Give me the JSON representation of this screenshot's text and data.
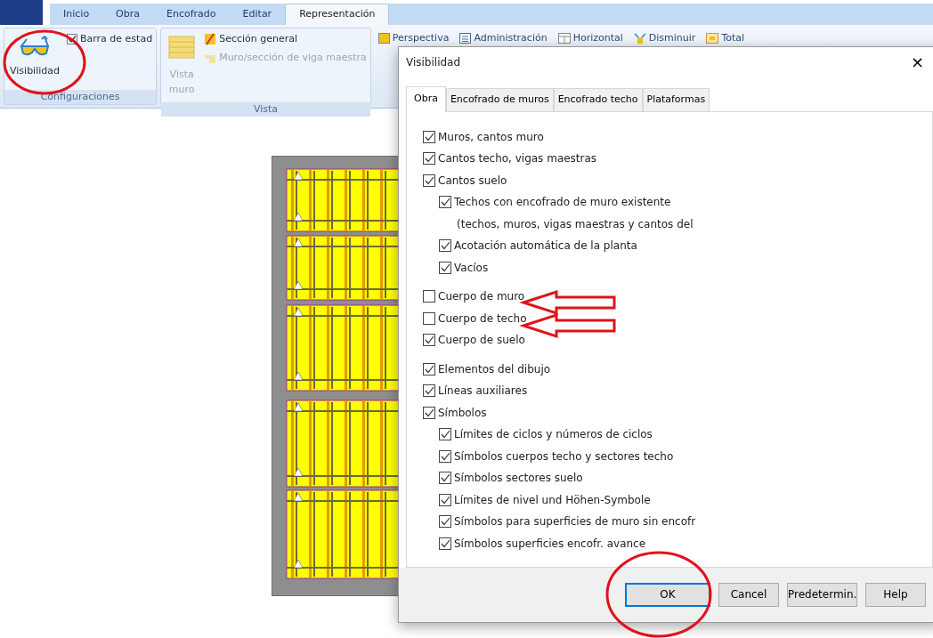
{
  "ribbon_tabs": [
    {
      "label": "Inicio",
      "selected": false
    },
    {
      "label": "Obra",
      "selected": false
    },
    {
      "label": "Encofrado",
      "selected": false
    },
    {
      "label": "Editar",
      "selected": false
    },
    {
      "label": "Representación",
      "selected": true
    }
  ],
  "ribbon_groups": [
    {
      "title": "Configuraciones",
      "items": [
        {
          "kind": "large",
          "label": "Visibilidad",
          "disabled": false
        },
        {
          "kind": "check",
          "label": "Barra de estad",
          "checked": true,
          "disabled": false
        }
      ]
    },
    {
      "title": "Vista",
      "items": [
        {
          "kind": "large",
          "label": "Vista muro",
          "disabled": true
        },
        {
          "kind": "small",
          "label": "Sección general",
          "disabled": false
        },
        {
          "kind": "small",
          "label": "Muro/sección de viga maestra",
          "disabled": true
        }
      ]
    }
  ],
  "ribbon_partial_items": [
    {
      "label": "Perspectiva"
    },
    {
      "label": "Administración"
    },
    {
      "label": "Horizontal"
    },
    {
      "label": "Disminuir"
    },
    {
      "label": "Total"
    }
  ],
  "dialog": {
    "title": "Visibilidad",
    "close": "×",
    "tabs": [
      {
        "label": "Obra",
        "selected": true
      },
      {
        "label": "Encofrado de muros",
        "selected": false
      },
      {
        "label": "Encofrado techo",
        "selected": false
      },
      {
        "label": "Plataformas",
        "selected": false
      }
    ],
    "groups": [
      {
        "items": [
          {
            "label": "Muros, cantos muro",
            "checked": true
          },
          {
            "label": "Cantos techo, vigas maestras",
            "checked": true
          },
          {
            "label": "Cantos suelo",
            "checked": true,
            "children": [
              {
                "label": "Techos con encofrado de muro existente",
                "note": "(techos, muros, vigas maestras y cantos del",
                "checked": true
              },
              {
                "label": "Acotación automática de la planta",
                "checked": true
              },
              {
                "label": "Vacíos",
                "checked": true
              }
            ]
          }
        ]
      },
      {
        "items": [
          {
            "label": "Cuerpo de muro",
            "checked": false
          },
          {
            "label": "Cuerpo de techo",
            "checked": false
          },
          {
            "label": "Cuerpo de suelo",
            "checked": true
          }
        ]
      },
      {
        "items": [
          {
            "label": "Elementos del dibujo",
            "checked": true
          },
          {
            "label": "Líneas auxiliares",
            "checked": true
          },
          {
            "label": "Símbolos",
            "checked": true,
            "children": [
              {
                "label": "Límites de ciclos y números de ciclos",
                "checked": true
              },
              {
                "label": "Símbolos cuerpos techo y sectores techo",
                "checked": true
              },
              {
                "label": "Símbolos sectores suelo",
                "checked": true
              },
              {
                "label": "Límites de nivel und Höhen-Symbole",
                "checked": true
              },
              {
                "label": "Símbolos para superficies de muro sin encofr",
                "checked": true
              },
              {
                "label": "Símbolos superficies encofr. avance",
                "checked": true
              }
            ]
          }
        ]
      }
    ],
    "buttons": [
      {
        "label": "OK",
        "default": true
      },
      {
        "label": "Cancel",
        "default": false
      },
      {
        "label": "Predetermin.",
        "default": false
      },
      {
        "label": "Help",
        "default": false
      }
    ]
  }
}
